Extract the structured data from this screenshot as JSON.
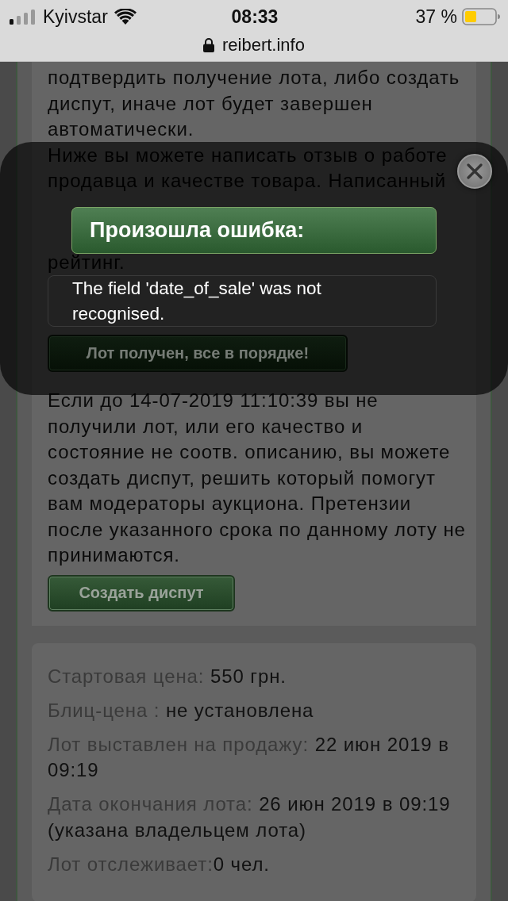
{
  "status_bar": {
    "carrier": "Kyivstar",
    "time": "08:33",
    "battery": "37 %"
  },
  "address_bar": {
    "url": "reibert.info"
  },
  "confirm_notice": {
    "lines": [
      "подтвердить получение лота, либо создать",
      "диспут, иначе лот будет завершен",
      "автоматически."
    ]
  },
  "review_notice": {
    "lines_above": [
      "Ниже вы можете написать отзыв о работе",
      "продавца и качестве товара. Написанный"
    ],
    "lines_below": [
      "рейтинг."
    ]
  },
  "confirm_button": "Лот получен, все в порядке!",
  "dispute_notice": {
    "lines": [
      "Если до 14-07-2019 11:10:39 вы не",
      "получили лот, или его качество и",
      "состояние не соотв. описанию, вы можете",
      "создать диспут, решить который помогут",
      "вам модераторы аукциона. Претензии",
      "после указанного срока по данному лоту не",
      "принимаются."
    ]
  },
  "dispute_button": "Создать диспут",
  "lot_info": [
    {
      "label": "Стартовая цена:",
      "value": "550 грн."
    },
    {
      "label": "Блиц-цена :",
      "value": "не установлена"
    },
    {
      "label": "Лот выставлен на продажу:",
      "value": "22 июн 2019 в 09:19"
    },
    {
      "label": "Дата окончания лота:",
      "value": "26 июн 2019 в 09:19 (указана владельцем лота)"
    },
    {
      "label": "Лот отслеживает:",
      "value": "0 чел.",
      "tight": true
    }
  ],
  "modal": {
    "title": "Произошла ошибка:",
    "message": "The field 'date_of_sale' was not recognised."
  }
}
